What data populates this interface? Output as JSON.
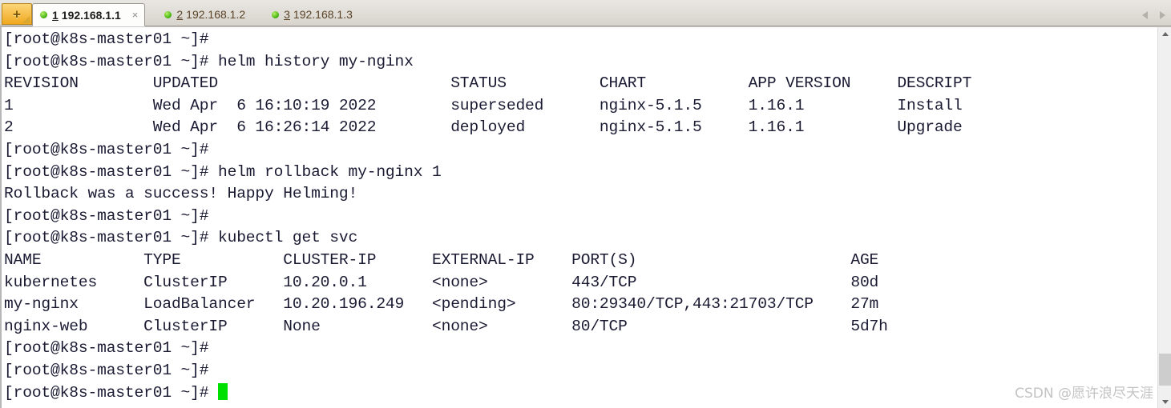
{
  "window": {
    "app_kind": "ssh-terminal",
    "accent_orange": "#f0a81e",
    "cursor_color": "#00e000",
    "status_dot_color": "#3fae09",
    "terminal_fg": "#1a1a33",
    "terminal_bg": "#ffffff"
  },
  "tabbar": {
    "new_tab_label": "+",
    "scroll_left_label": "◂",
    "scroll_right_label": "▸",
    "tabs": [
      {
        "number": "1",
        "label": "192.168.1.1",
        "close_label": "×",
        "active": true
      },
      {
        "number": "2",
        "label": "192.168.1.2",
        "close_label": "",
        "active": false
      },
      {
        "number": "3",
        "label": "192.168.1.3",
        "close_label": "",
        "active": false
      }
    ]
  },
  "terminal": {
    "prompt": "[root@k8s-master01 ~]#",
    "lines": [
      "[root@k8s-master01 ~]#",
      "[root@k8s-master01 ~]# helm history my-nginx",
      "REVISION        UPDATED                         STATUS          CHART           APP VERSION     DESCRIPT",
      "1               Wed Apr  6 16:10:19 2022        superseded      nginx-5.1.5     1.16.1          Install",
      "2               Wed Apr  6 16:26:14 2022        deployed        nginx-5.1.5     1.16.1          Upgrade",
      "[root@k8s-master01 ~]#",
      "[root@k8s-master01 ~]# helm rollback my-nginx 1",
      "Rollback was a success! Happy Helming!",
      "[root@k8s-master01 ~]#",
      "[root@k8s-master01 ~]# kubectl get svc",
      "NAME           TYPE           CLUSTER-IP      EXTERNAL-IP    PORT(S)                       AGE",
      "kubernetes     ClusterIP      10.20.0.1       <none>         443/TCP                       80d",
      "my-nginx       LoadBalancer   10.20.196.249   <pending>      80:29340/TCP,443:21703/TCP    27m",
      "nginx-web      ClusterIP      None            <none>         80/TCP                        5d7h",
      "[root@k8s-master01 ~]#",
      "[root@k8s-master01 ~]#"
    ],
    "last_line": "[root@k8s-master01 ~]# ",
    "commands": [
      "helm history my-nginx",
      "helm rollback my-nginx 1",
      "kubectl get svc"
    ],
    "helm_history": {
      "headers": [
        "REVISION",
        "UPDATED",
        "STATUS",
        "CHART",
        "APP VERSION",
        "DESCRIPT"
      ],
      "rows": [
        [
          "1",
          "Wed Apr  6 16:10:19 2022",
          "superseded",
          "nginx-5.1.5",
          "1.16.1",
          "Install"
        ],
        [
          "2",
          "Wed Apr  6 16:26:14 2022",
          "deployed",
          "nginx-5.1.5",
          "1.16.1",
          "Upgrade"
        ]
      ]
    },
    "rollback_message": "Rollback was a success! Happy Helming!",
    "kubectl_get_svc": {
      "headers": [
        "NAME",
        "TYPE",
        "CLUSTER-IP",
        "EXTERNAL-IP",
        "PORT(S)",
        "AGE"
      ],
      "rows": [
        [
          "kubernetes",
          "ClusterIP",
          "10.20.0.1",
          "<none>",
          "443/TCP",
          "80d"
        ],
        [
          "my-nginx",
          "LoadBalancer",
          "10.20.196.249",
          "<pending>",
          "80:29340/TCP,443:21703/TCP",
          "27m"
        ],
        [
          "nginx-web",
          "ClusterIP",
          "None",
          "<none>",
          "80/TCP",
          "5d7h"
        ]
      ]
    }
  },
  "scrollbar": {
    "up_label": "∧",
    "down_label": "∨"
  },
  "watermark": {
    "text": "CSDN @愿许浪尽天涯"
  }
}
